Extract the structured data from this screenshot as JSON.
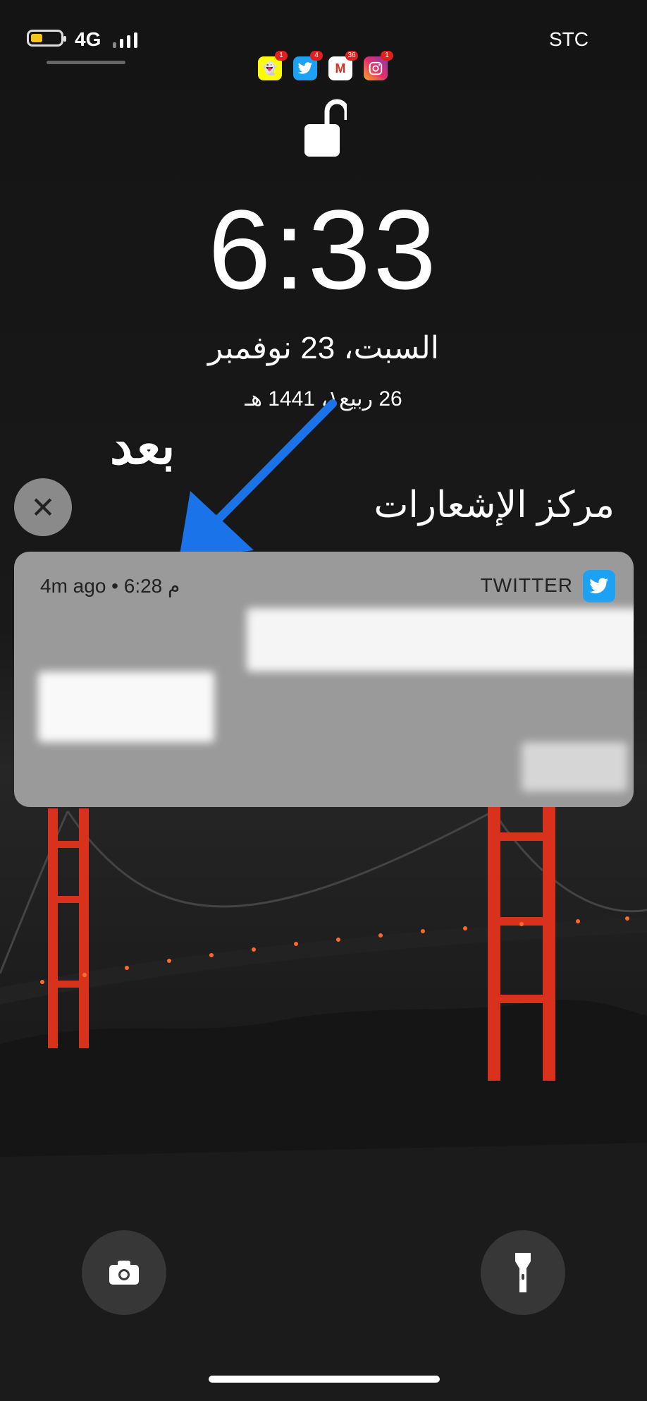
{
  "status_bar": {
    "network": "4G",
    "carrier": "STC",
    "battery_level": 0.34,
    "battery_color": "#f5c518"
  },
  "app_icons": [
    {
      "name": "snapchat-icon",
      "badge": "1",
      "color": "#fffc00"
    },
    {
      "name": "twitter-icon",
      "badge": "4",
      "color": "#1da1f2"
    },
    {
      "name": "gmail-icon",
      "badge": "36",
      "color": "#ffffff"
    },
    {
      "name": "instagram-icon",
      "badge": "1",
      "color": "#c13584"
    }
  ],
  "lock": {
    "time": "6:33",
    "date": "السبت، 23 نوفمبر",
    "hijri_date": "26 ربيع١، 1441 هـ"
  },
  "annotation": {
    "word": "بعد",
    "arrow_color": "#1a73e8"
  },
  "notification_center": {
    "title": "مركز الإشعارات",
    "close_icon": "close-icon"
  },
  "notification": {
    "time": "4m ago • 6:28 م",
    "app_name": "TWITTER",
    "app_icon": "twitter-icon"
  },
  "quick_actions": {
    "left": "camera-icon",
    "right": "flashlight-icon"
  }
}
